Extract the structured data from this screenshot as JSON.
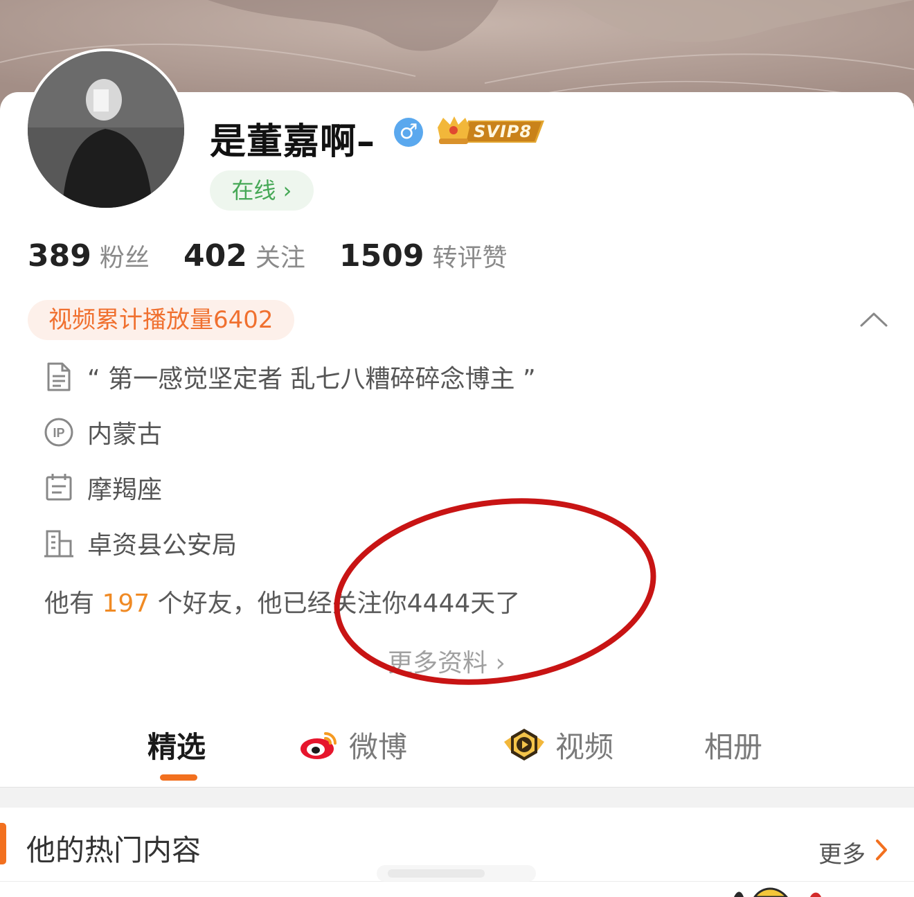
{
  "profile": {
    "name": "是董嘉啊–",
    "gender_symbol": "♂",
    "vip_label": "SVIP8",
    "online_label": "在线 ›"
  },
  "stats": [
    {
      "num": "389",
      "label": "粉丝"
    },
    {
      "num": "402",
      "label": "关注"
    },
    {
      "num": "1509",
      "label": "转评赞"
    }
  ],
  "views_badge": "视频累计播放量6402",
  "info": {
    "bio": "“ 第一感觉坚定者 乱七八糟碎碎念博主 ”",
    "ip": "内蒙古",
    "zodiac": "摩羯座",
    "work": "卓资县公安局"
  },
  "friends": {
    "prefix": "他有",
    "count": "197",
    "suffix": "个好友，他已经关注你4444天了"
  },
  "more_info": "更多资料 ›",
  "tabs": [
    {
      "label": "精选",
      "active": true
    },
    {
      "label": "微博"
    },
    {
      "label": "视频"
    },
    {
      "label": "相册"
    }
  ],
  "hot": {
    "title": "他的热门内容",
    "more": "更多"
  },
  "colors": {
    "accent": "#f2701f",
    "online_green": "#46a856",
    "annotation_red": "#c81414"
  },
  "icons": [
    "gender-male-icon",
    "svip-crown-icon",
    "document-icon",
    "ip-icon",
    "calendar-icon",
    "building-icon",
    "weibo-icon",
    "video-icon",
    "chevron-up-icon",
    "chevron-right-icon"
  ]
}
